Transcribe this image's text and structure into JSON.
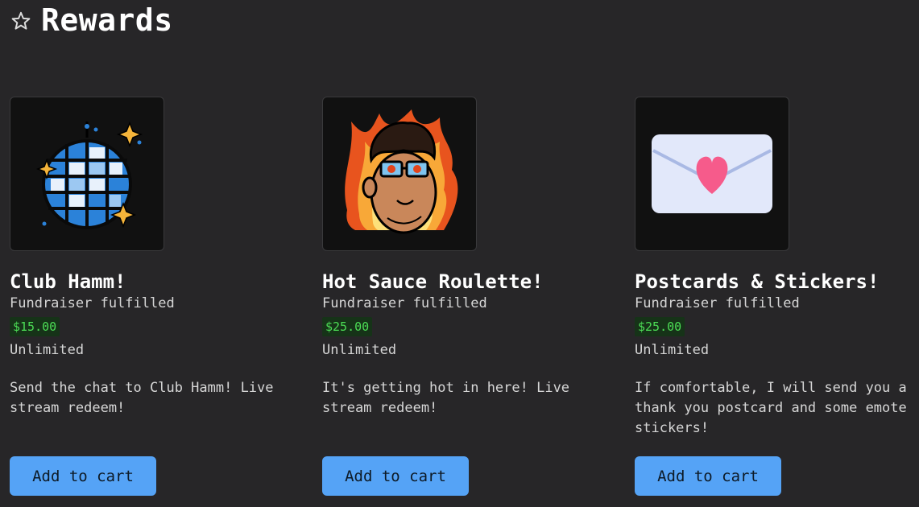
{
  "page": {
    "title": "Rewards",
    "title_icon": "star-outline-icon"
  },
  "rewards": [
    {
      "image": "disco-ball-image",
      "title": "Club Hamm!",
      "status": "Fundraiser fulfilled",
      "price": "$15.00",
      "quantity": "Unlimited",
      "description": "Send the chat to Club Hamm! Live stream redeem!",
      "button_label": "Add to cart"
    },
    {
      "image": "flaming-face-emote-image",
      "title": "Hot Sauce Roulette!",
      "status": "Fundraiser fulfilled",
      "price": "$25.00",
      "quantity": "Unlimited",
      "description": "It's getting hot in here! Live stream redeem!",
      "button_label": "Add to cart"
    },
    {
      "image": "heart-envelope-image",
      "title": "Postcards & Stickers!",
      "status": "Fundraiser fulfilled",
      "price": "$25.00",
      "quantity": "Unlimited",
      "description": "If comfortable, I will send you a thank you postcard and some emote stickers!",
      "button_label": "Add to cart"
    }
  ],
  "colors": {
    "background": "#272628",
    "button": "#55a3f6",
    "price_bg": "#163318",
    "price_text": "#4cdc55"
  }
}
